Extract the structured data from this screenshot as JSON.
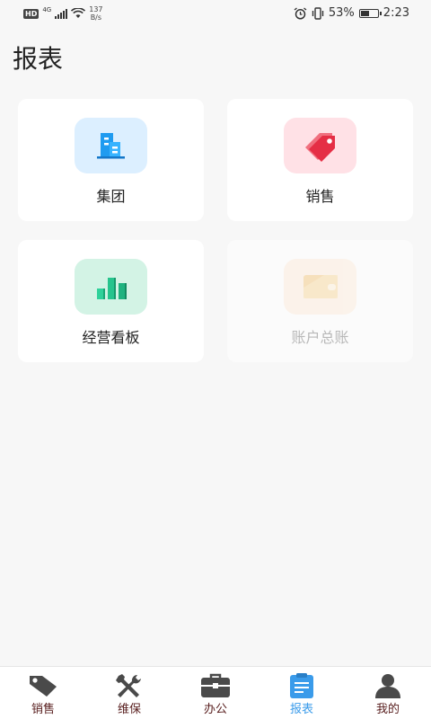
{
  "status_bar": {
    "hd": "HD",
    "network": "4G",
    "speed_value": "137",
    "speed_unit": "B/s",
    "battery_percent": "53%",
    "battery_level": 0.53,
    "time": "2:23"
  },
  "page": {
    "title": "报表"
  },
  "cards": [
    {
      "label": "集团",
      "icon": "building-icon",
      "bg": "#dcefff",
      "enabled": true
    },
    {
      "label": "销售",
      "icon": "price-tag-icon",
      "bg": "#ffe1e6",
      "enabled": true
    },
    {
      "label": "经营看板",
      "icon": "bar-chart-icon",
      "bg": "#d3f3e5",
      "enabled": true
    },
    {
      "label": "账户总账",
      "icon": "wallet-card-icon",
      "bg": "#fbe8d6",
      "enabled": false
    }
  ],
  "bottom_nav": {
    "active": "报表",
    "items": [
      {
        "label": "销售",
        "icon": "tag-icon"
      },
      {
        "label": "维保",
        "icon": "tools-icon"
      },
      {
        "label": "办公",
        "icon": "briefcase-icon"
      },
      {
        "label": "报表",
        "icon": "report-icon"
      },
      {
        "label": "我的",
        "icon": "user-icon"
      }
    ]
  },
  "colors": {
    "accent": "#3a9bea",
    "nav_text": "#5a2020",
    "background": "#f7f7f7"
  }
}
